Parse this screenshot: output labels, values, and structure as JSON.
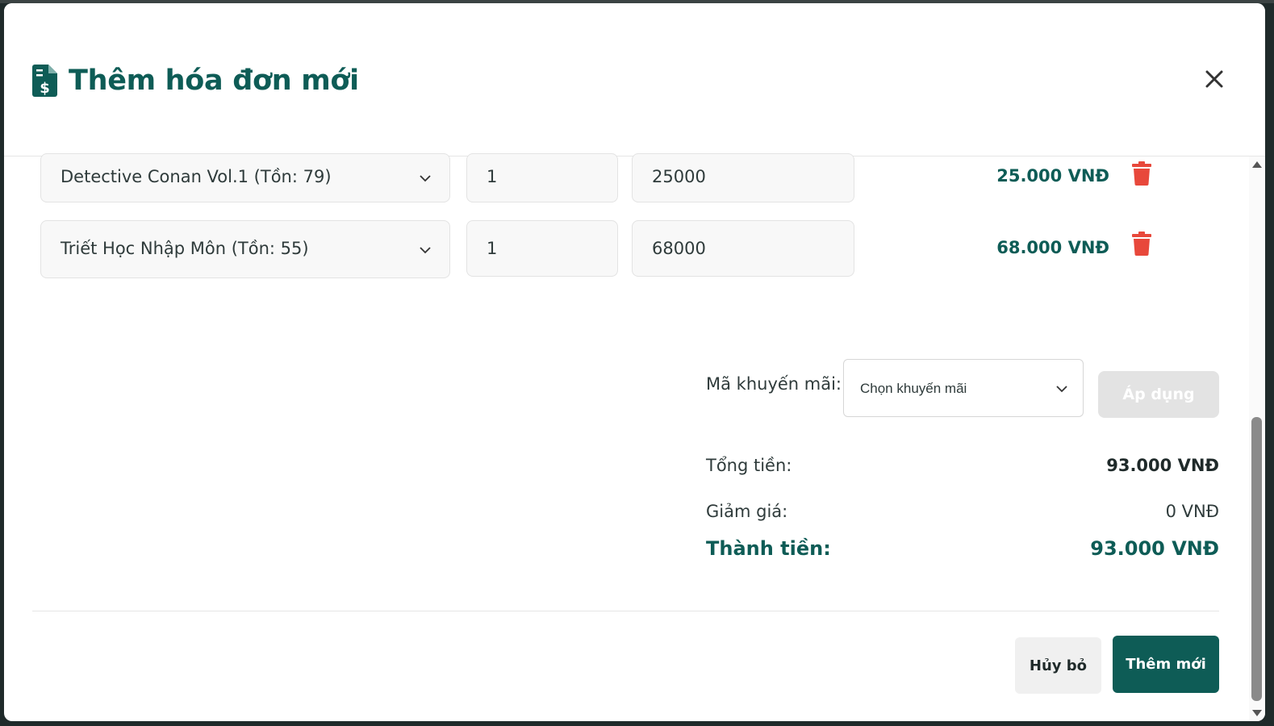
{
  "modal": {
    "title": "Thêm hóa đơn mới",
    "title_icon": "invoice-dollar-icon",
    "close_icon": "close-icon"
  },
  "items": [
    {
      "product": "Detective Conan Vol.1 (Tồn: 79)",
      "quantity": "1",
      "price": "25000",
      "line_total": "25.000 VNĐ"
    },
    {
      "product": "Triết Học Nhập Môn (Tồn: 55)",
      "quantity": "1",
      "price": "68000",
      "line_total": "68.000 VNĐ"
    }
  ],
  "promo": {
    "label": "Mã khuyến mãi:",
    "selected": "Chọn khuyến mãi",
    "apply_label": "Áp dụng"
  },
  "summary": {
    "total_label": "Tổng tiền:",
    "total_value": "93.000 VNĐ",
    "discount_label": "Giảm giá:",
    "discount_value": "0 VNĐ",
    "final_label": "Thành tiền:",
    "final_value": "93.000 VNĐ"
  },
  "footer": {
    "cancel_label": "Hủy bỏ",
    "submit_label": "Thêm mới"
  },
  "colors": {
    "primary": "#0e5c56",
    "danger": "#e8483b",
    "disabled": "#e3e3e3"
  }
}
